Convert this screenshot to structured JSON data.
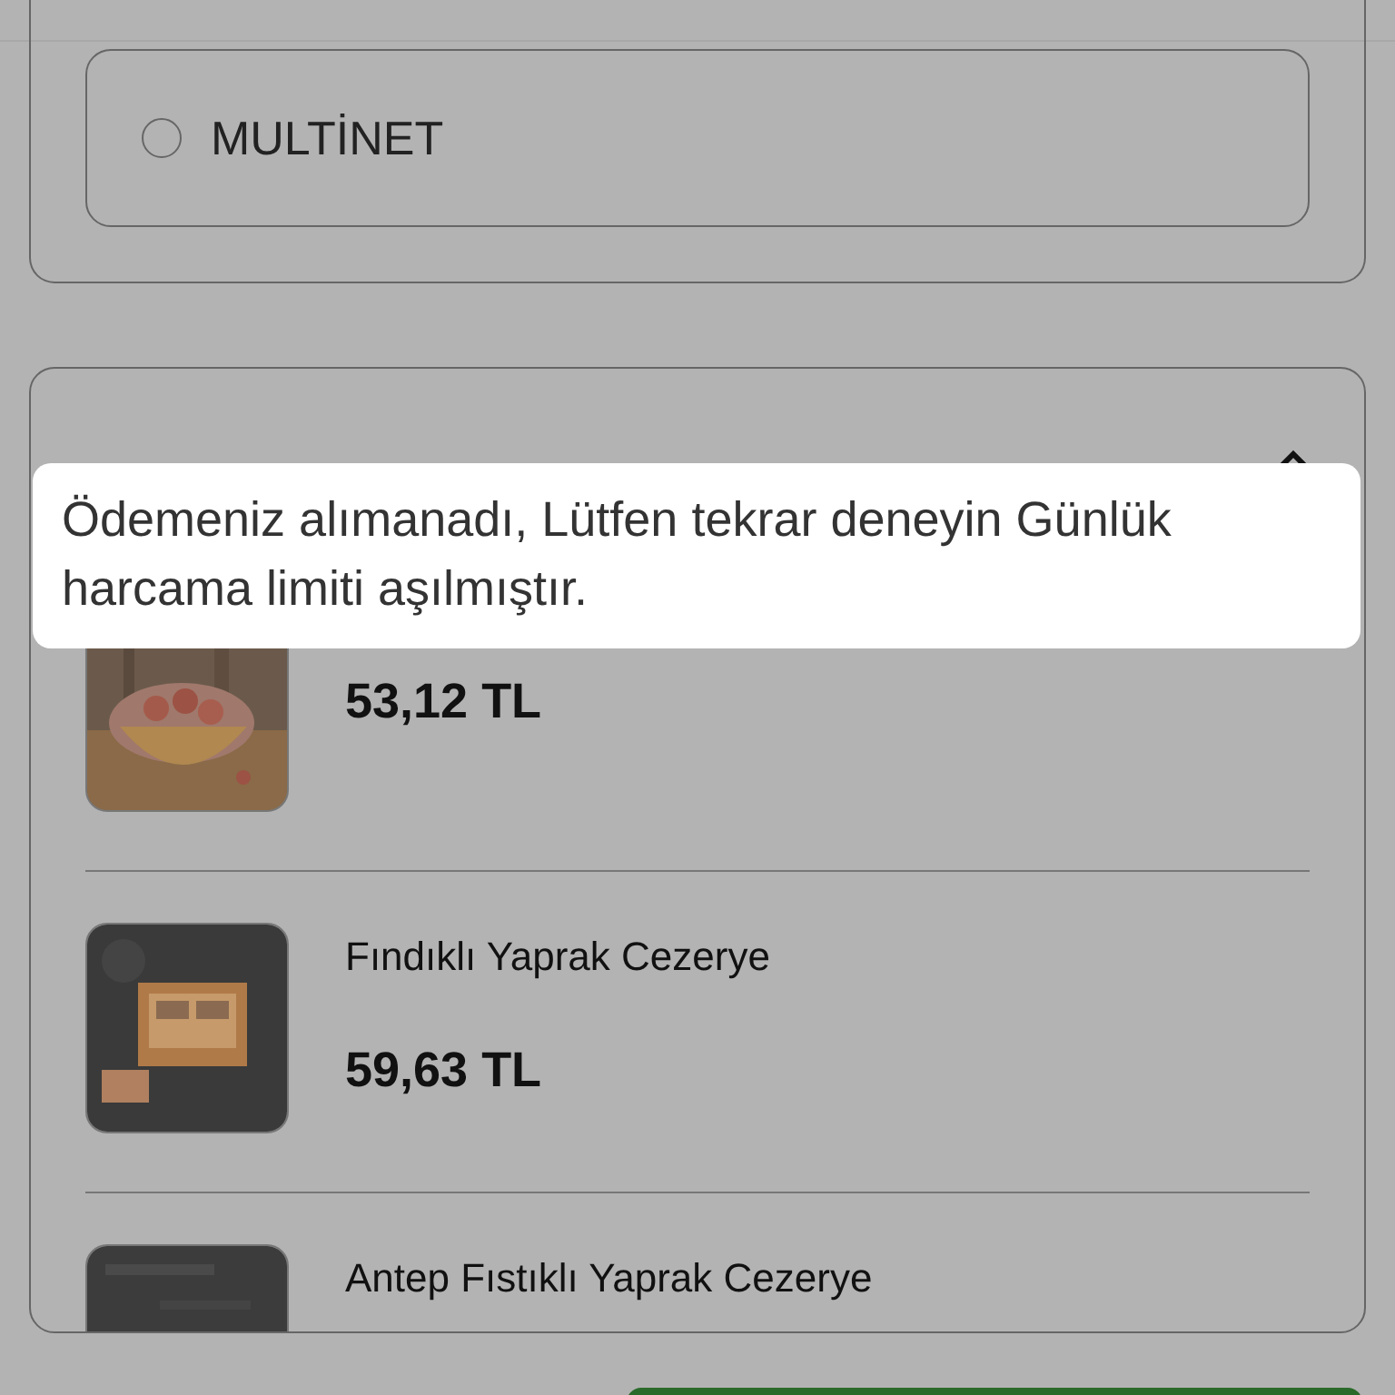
{
  "payment_options": [
    {
      "label": "MULTİNET",
      "selected": false
    }
  ],
  "order_summary": {
    "expanded": true,
    "items": [
      {
        "price": "53,12 TL",
        "kind": "peanuts"
      },
      {
        "name": "Fındıklı Yaprak Cezerye",
        "price": "59,63 TL",
        "kind": "box"
      },
      {
        "name": "Antep Fıstıklı Yaprak Cezerye",
        "kind": "dark"
      }
    ]
  },
  "toast": {
    "message": "Ödemeniz alımanadı, Lütfen tekrar deneyin Günlük harcama limiti aşılmıştır."
  }
}
